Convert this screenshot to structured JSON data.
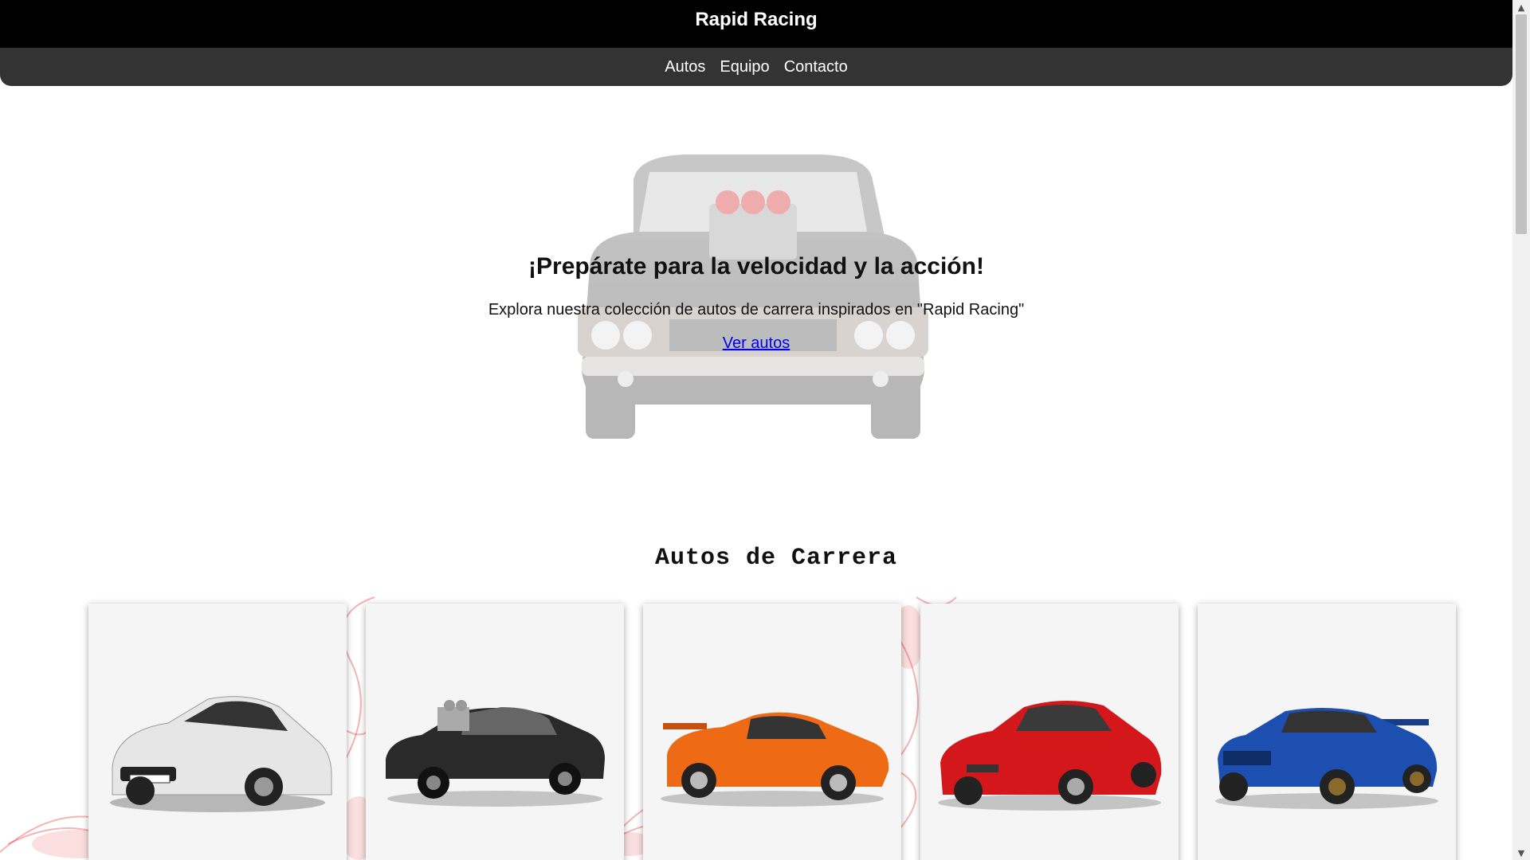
{
  "header": {
    "brand": "Rapid Racing"
  },
  "nav": {
    "items": [
      "Autos",
      "Equipo",
      "Contacto"
    ]
  },
  "hero": {
    "title": "¡Prepárate para la velocidad y la acción!",
    "subtitle": "Explora nuestra colección de autos de carrera inspirados en \"Rapid Racing\"",
    "cta": "Ver autos"
  },
  "section": {
    "title": "Autos de Carrera"
  },
  "cars": [
    {
      "icon": "car-silver-icon",
      "color": "#d8d8d8"
    },
    {
      "icon": "car-black-icon",
      "color": "#2a2a2a"
    },
    {
      "icon": "car-orange-icon",
      "color": "#ef6a14"
    },
    {
      "icon": "car-red-icon",
      "color": "#d3171a"
    },
    {
      "icon": "car-blue-icon",
      "color": "#1d4fb0"
    }
  ],
  "colors": {
    "topbar": "#000000",
    "navbar": "#333333",
    "link": "#0000ee",
    "smoke": "#e6262b"
  }
}
